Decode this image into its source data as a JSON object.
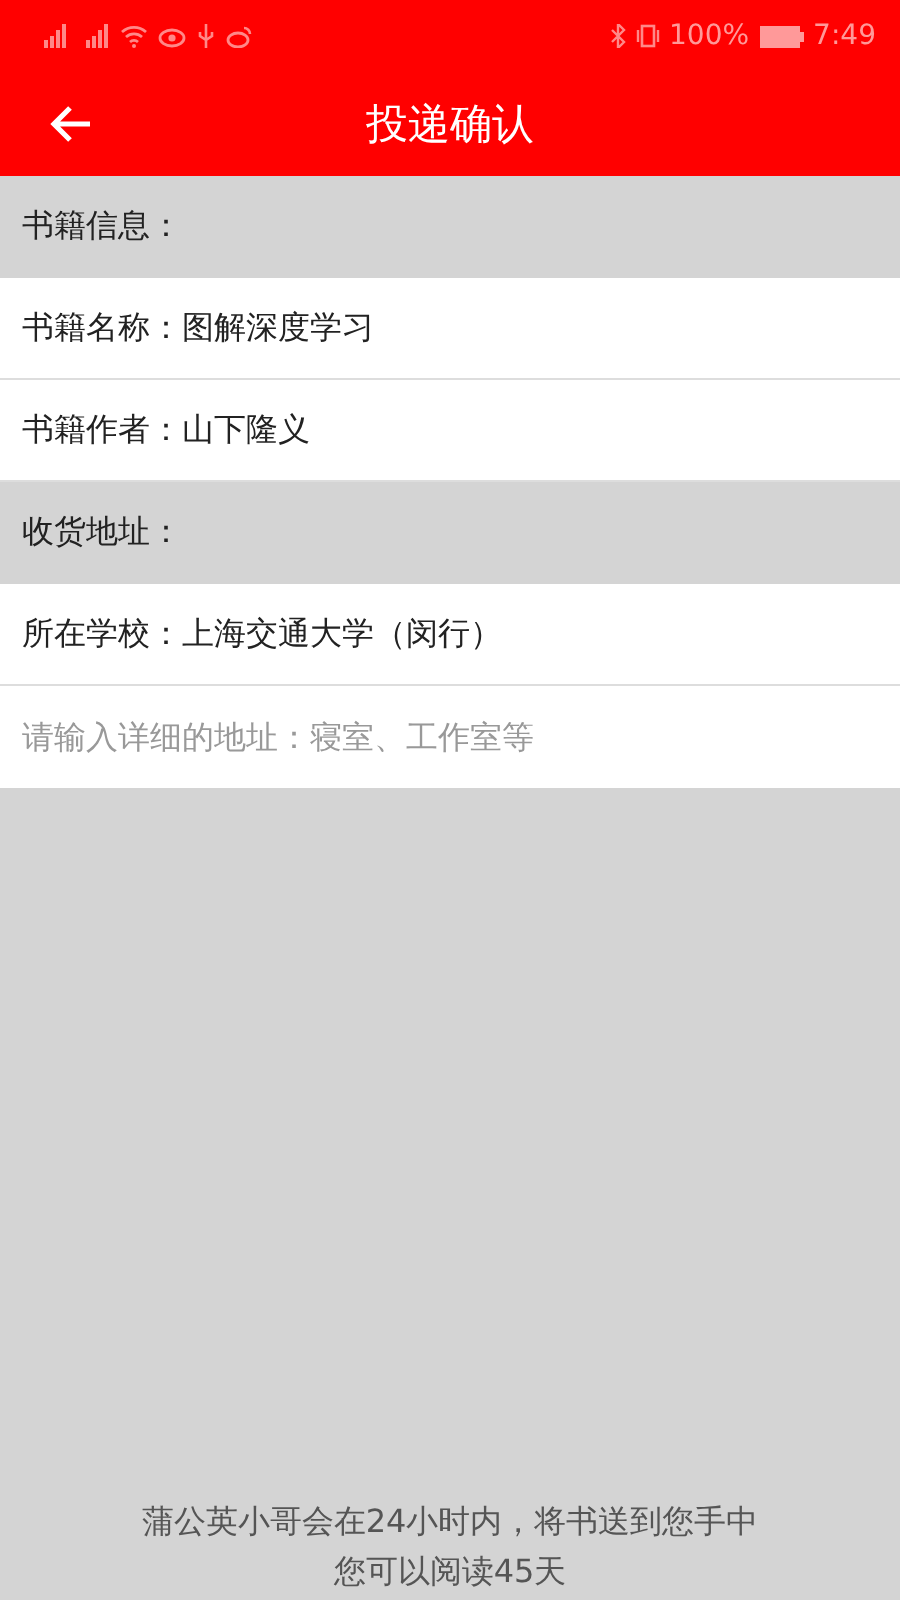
{
  "status_bar": {
    "battery": "100%",
    "time": "7:49"
  },
  "header": {
    "title": "投递确认"
  },
  "rows": [
    {
      "kind": "section",
      "label": "书籍信息："
    },
    {
      "kind": "info",
      "label": "书籍名称：",
      "value": "图解深度学习"
    },
    {
      "kind": "info",
      "label": "书籍作者：",
      "value": "山下隆义"
    },
    {
      "kind": "section",
      "label": "收货地址："
    },
    {
      "kind": "info",
      "label": "所在学校：",
      "value": "上海交通大学（闵行）"
    },
    {
      "kind": "input",
      "placeholder": "请输入详细的地址：寝室、工作室等"
    }
  ],
  "footer": [
    "蒲公英小哥会在24小时内，将书送到您手中",
    "您可以阅读45天"
  ]
}
